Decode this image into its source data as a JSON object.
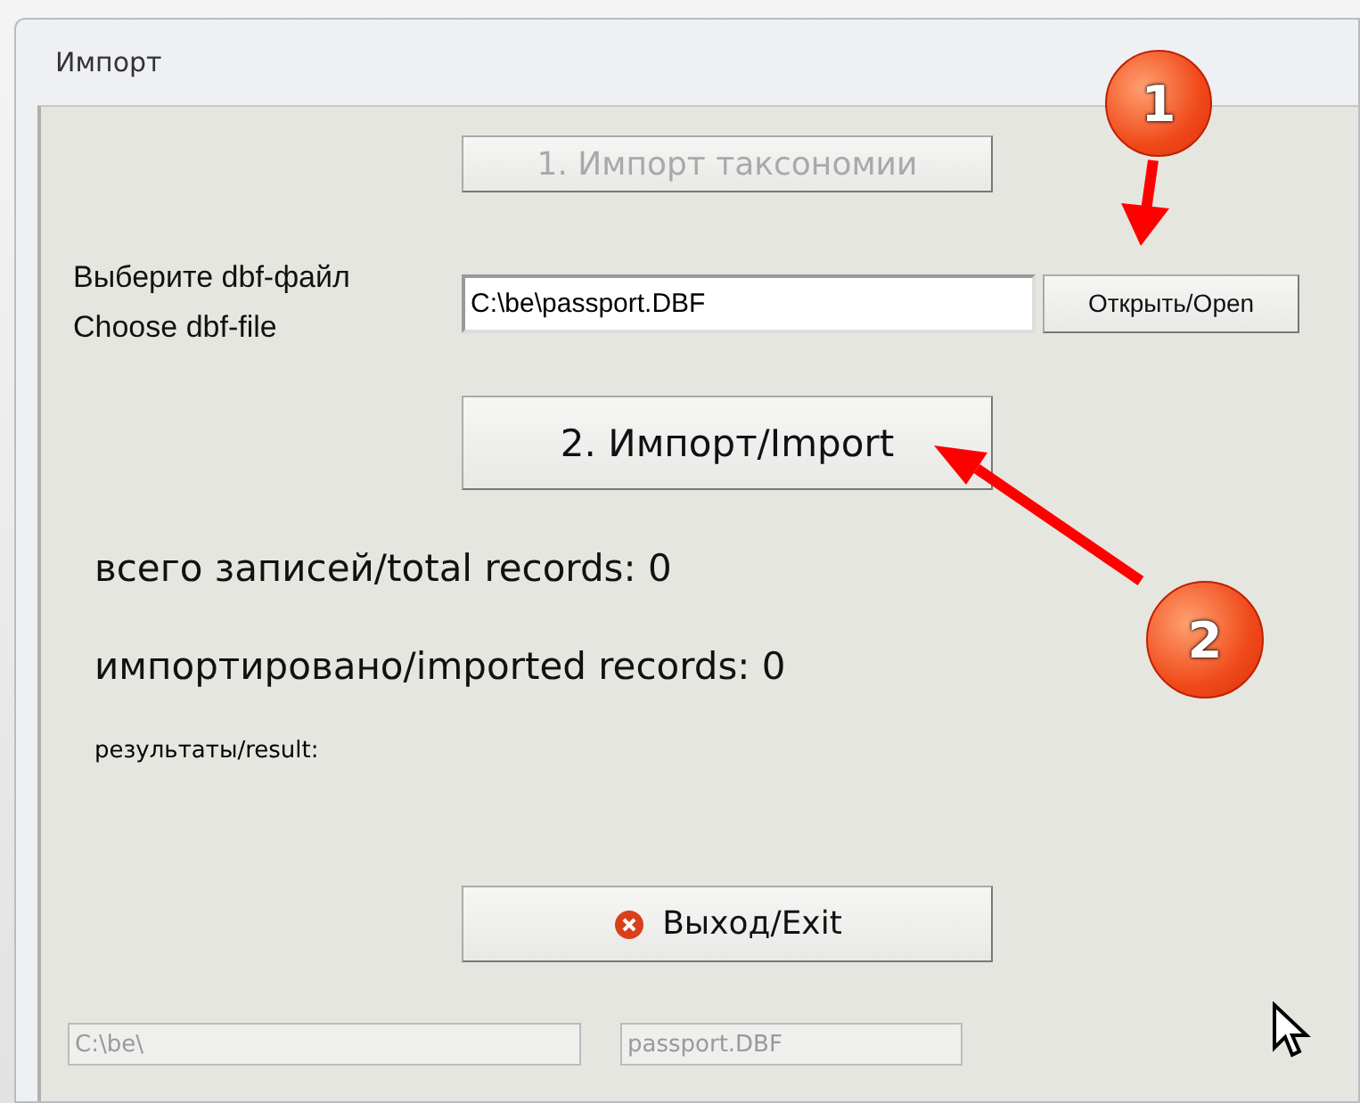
{
  "window": {
    "title": "Импорт"
  },
  "taxonomy_button": {
    "label": "1. Импорт таксономии",
    "disabled": true
  },
  "file_prompt": [
    "Выберите dbf-файл",
    "Choose dbf-file"
  ],
  "file_field": {
    "value": "C:\\be\\passport.DBF"
  },
  "open_button": {
    "label": "Открыть/Open"
  },
  "import_button": {
    "label": "2. Импорт/Import"
  },
  "total_records": "всего записей/total records: 0",
  "imported_records": "импортировано/imported records: 0",
  "result_label": "результаты/result:",
  "exit_button": {
    "label": "Выход/Exit"
  },
  "status_fields": [
    {
      "value": "C:\\be\\",
      "disabled": true
    },
    {
      "value": "passport.DBF",
      "disabled": true
    }
  ],
  "callouts": [
    {
      "number": "1"
    },
    {
      "number": "2"
    }
  ]
}
